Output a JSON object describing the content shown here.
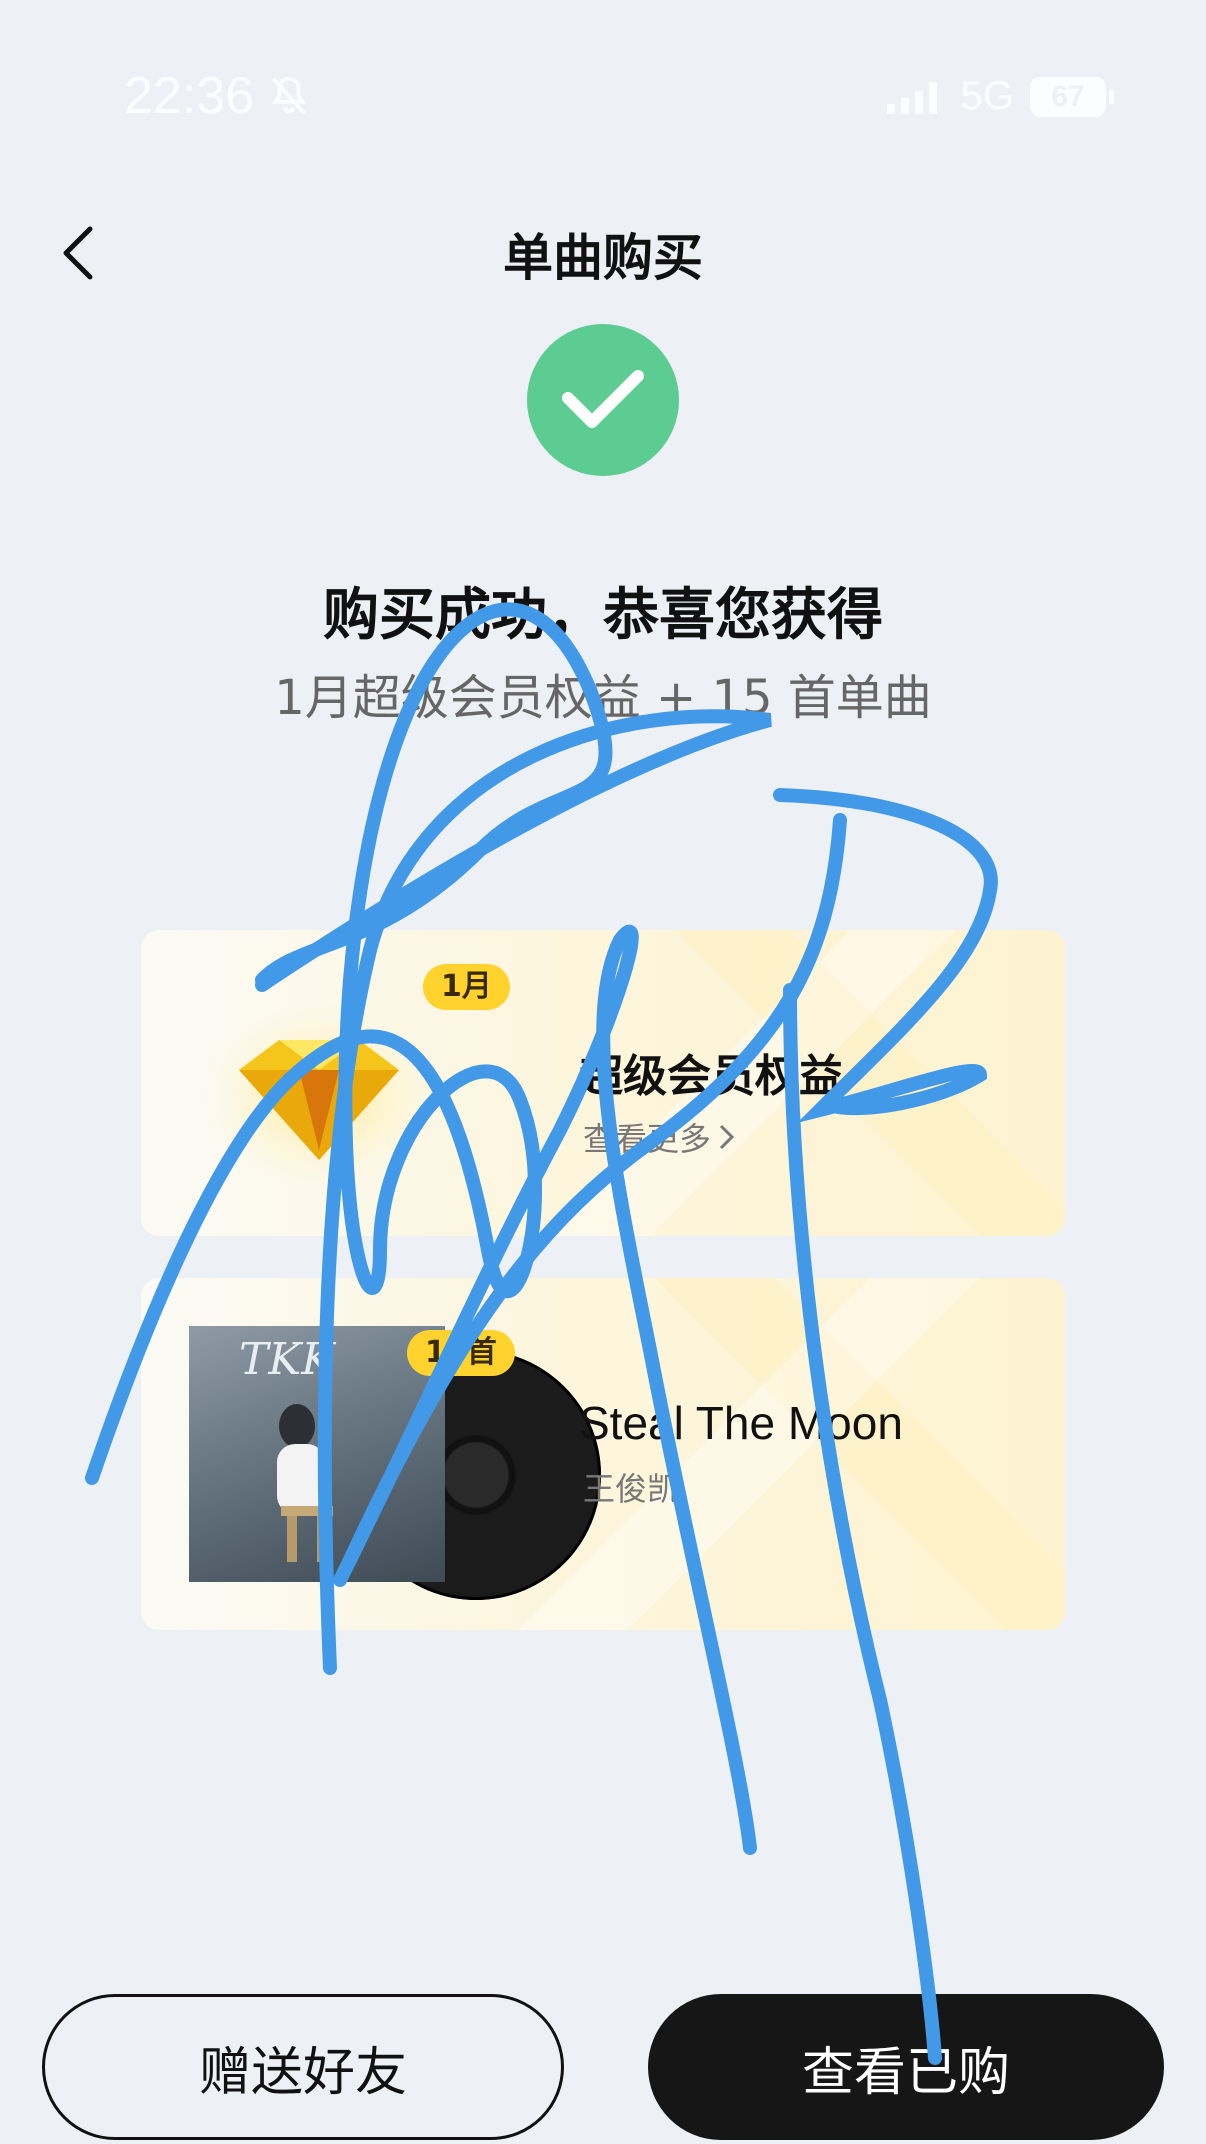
{
  "status_bar": {
    "time": "22:36",
    "network": "5G",
    "battery": "67",
    "icons": [
      "bell-muted-icon",
      "signal-icon",
      "battery-icon"
    ]
  },
  "header": {
    "title": "单曲购买",
    "back_icon": "chevron-left-icon"
  },
  "result": {
    "icon": "checkmark-icon",
    "title": "购买成功，恭喜您获得",
    "subtitle": "1月超级会员权益 + 15 首单曲"
  },
  "cards": {
    "vip": {
      "badge": "1月",
      "title": "超级会员权益",
      "link": "查看更多",
      "icon": "gem-icon"
    },
    "song": {
      "badge": "15首",
      "title": "Steal The Moon",
      "artist": "王俊凯",
      "cover_text": "TKK"
    }
  },
  "buttons": {
    "gift": "赠送好友",
    "view_purchased": "查看已购"
  },
  "colors": {
    "background": "#edf1f5",
    "success": "#5dcc93",
    "badge": "#ffd22e",
    "primary_button": "#161616",
    "scribble": "#4299e8"
  }
}
